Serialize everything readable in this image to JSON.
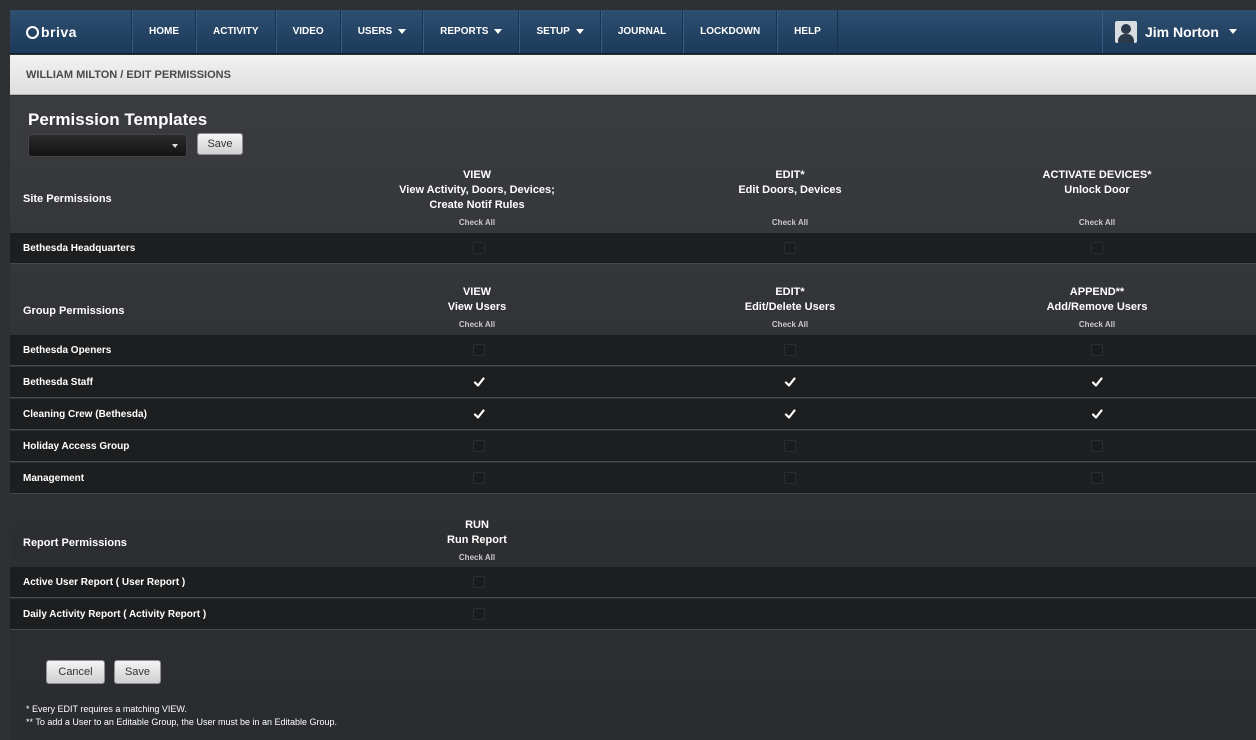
{
  "nav": {
    "logo": "briva",
    "items": [
      "HOME",
      "ACTIVITY",
      "VIDEO",
      "USERS",
      "REPORTS",
      "SETUP",
      "JOURNAL",
      "LOCKDOWN",
      "HELP"
    ],
    "user_name": "Jim Norton"
  },
  "breadcrumb": "WILLIAM MILTON / EDIT PERMISSIONS",
  "templates": {
    "title": "Permission Templates",
    "select_value": "",
    "save_label": "Save"
  },
  "site": {
    "title": "Site Permissions",
    "col1": {
      "l1": "VIEW",
      "l2": "View Activity, Doors, Devices;",
      "l3": "Create Notif Rules"
    },
    "col2": {
      "l1": "EDIT*",
      "l2": "Edit Doors, Devices"
    },
    "col3": {
      "l1": "ACTIVATE DEVICES*",
      "l2": "Unlock Door"
    },
    "check_all": "Check All",
    "rows": [
      {
        "label": "Bethesda Headquarters"
      }
    ]
  },
  "group": {
    "title": "Group Permissions",
    "col1": {
      "l1": "VIEW",
      "l2": "View Users"
    },
    "col2": {
      "l1": "EDIT*",
      "l2": "Edit/Delete Users"
    },
    "col3": {
      "l1": "APPEND**",
      "l2": "Add/Remove Users"
    },
    "check_all": "Check All",
    "rows": [
      {
        "label": "Bethesda Openers"
      },
      {
        "label": "Bethesda Staff"
      },
      {
        "label": "Cleaning Crew (Bethesda)"
      },
      {
        "label": "Holiday Access Group"
      },
      {
        "label": "Management"
      }
    ]
  },
  "report": {
    "title": "Report Permissions",
    "col1": {
      "l1": "RUN",
      "l2": "Run Report"
    },
    "check_all": "Check All",
    "rows": [
      {
        "label": "Active User Report ( User Report )"
      },
      {
        "label": "Daily Activity Report ( Activity Report )"
      }
    ]
  },
  "actions": {
    "cancel": "Cancel",
    "save": "Save"
  },
  "footnotes": [
    "* Every EDIT requires a matching VIEW.",
    "** To add a User to an Editable Group, the User must be in an Editable Group."
  ],
  "checkbox_state": {
    "site": [
      [
        false,
        false,
        false
      ]
    ],
    "group": [
      [
        false,
        false,
        false
      ],
      [
        true,
        true,
        true
      ],
      [
        true,
        true,
        true
      ],
      [
        false,
        false,
        false
      ],
      [
        false,
        false,
        false
      ]
    ],
    "report": [
      [
        false
      ],
      [
        false
      ]
    ]
  }
}
